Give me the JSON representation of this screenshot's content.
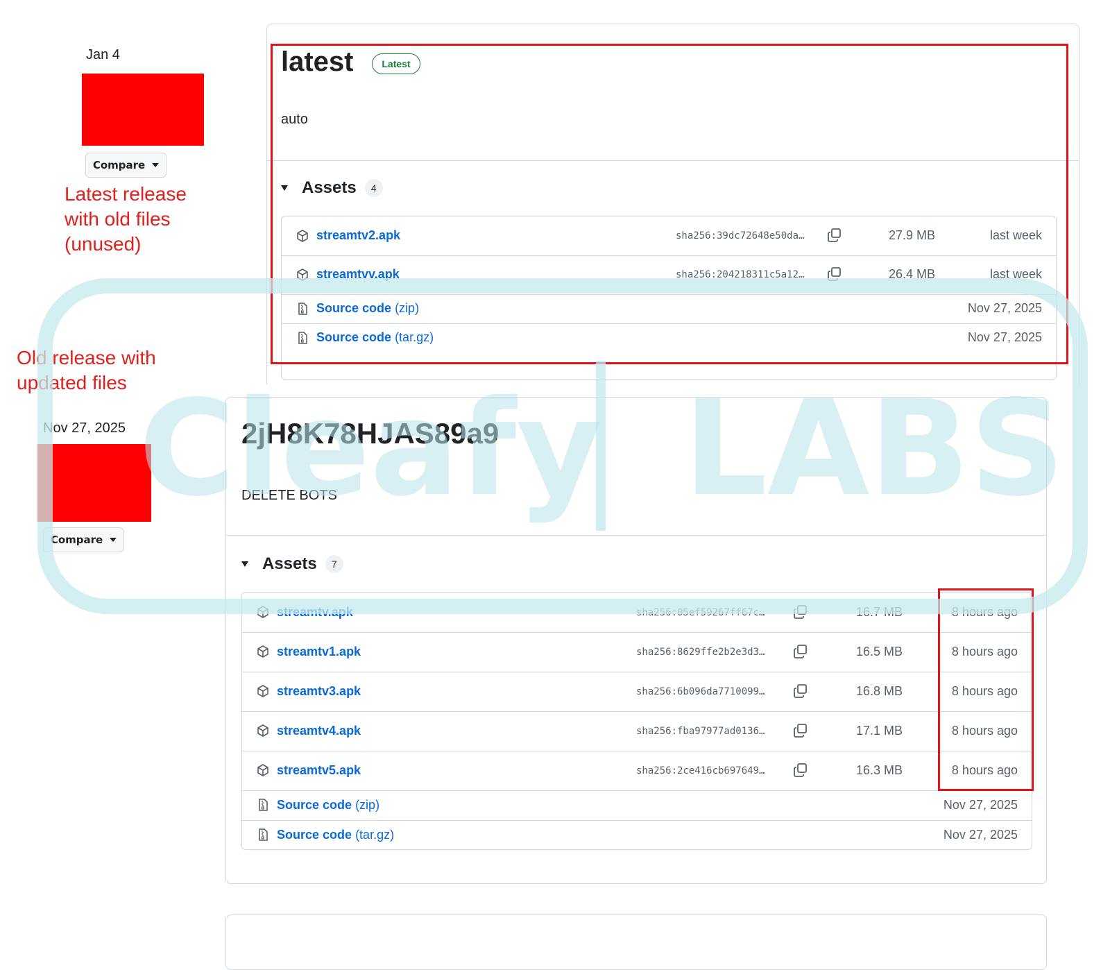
{
  "release_latest": {
    "date": "Jan 4",
    "compare_label": "Compare",
    "title": "latest",
    "badge": "Latest",
    "body": "auto",
    "assets_label": "Assets",
    "assets_count": "4",
    "assets": [
      {
        "name": "streamtv2.apk",
        "sha": "sha256:39dc72648e50da…",
        "size": "27.9 MB",
        "when": "last week"
      },
      {
        "name": "streamtvv.apk",
        "sha": "sha256:204218311c5a12…",
        "size": "26.4 MB",
        "when": "last week"
      }
    ],
    "source": [
      {
        "name": "Source code",
        "ext": "(zip)",
        "when": "Nov 27, 2025"
      },
      {
        "name": "Source code",
        "ext": "(tar.gz)",
        "when": "Nov 27, 2025"
      }
    ]
  },
  "release_old": {
    "date": "Nov 27, 2025",
    "compare_label": "Compare",
    "title": "2jH8K78HJAS89a9",
    "body": "DELETE BOTS",
    "assets_label": "Assets",
    "assets_count": "7",
    "assets": [
      {
        "name": "streamtv.apk",
        "sha": "sha256:05ef59267ff67c…",
        "size": "16.7 MB",
        "when": "8 hours ago"
      },
      {
        "name": "streamtv1.apk",
        "sha": "sha256:8629ffe2b2e3d3…",
        "size": "16.5 MB",
        "when": "8 hours ago"
      },
      {
        "name": "streamtv3.apk",
        "sha": "sha256:6b096da7710099…",
        "size": "16.8 MB",
        "when": "8 hours ago"
      },
      {
        "name": "streamtv4.apk",
        "sha": "sha256:fba97977ad0136…",
        "size": "17.1 MB",
        "when": "8 hours ago"
      },
      {
        "name": "streamtv5.apk",
        "sha": "sha256:2ce416cb697649…",
        "size": "16.3 MB",
        "when": "8 hours ago"
      }
    ],
    "source": [
      {
        "name": "Source code",
        "ext": "(zip)",
        "when": "Nov 27, 2025"
      },
      {
        "name": "Source code",
        "ext": "(tar.gz)",
        "when": "Nov 27, 2025"
      }
    ]
  },
  "annotations": {
    "latest_note": [
      "Latest release",
      "with old files",
      "(unused)"
    ],
    "old_note": [
      "Old release with",
      "updated files"
    ]
  },
  "watermark": {
    "left": "Cleafy",
    "right": "LABS"
  },
  "colors": {
    "annotation_red": "#e0201c",
    "link_blue": "#0969da",
    "badge_green": "#1a7f37",
    "redaction": "#ff0000"
  }
}
